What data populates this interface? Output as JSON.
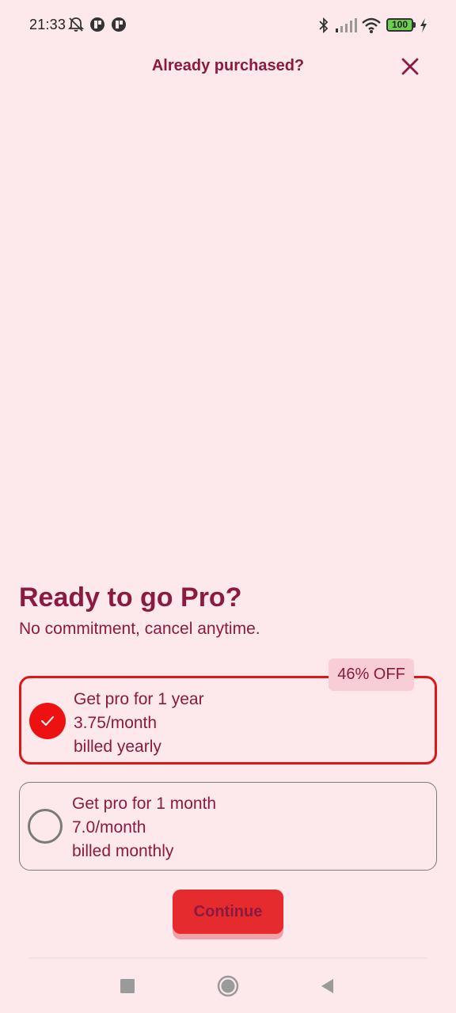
{
  "status_bar": {
    "time": "21:33",
    "battery": "100",
    "icons": [
      "bell-off-icon",
      "app-notification-icon",
      "app-notification-icon",
      "bluetooth-icon",
      "signal-icon",
      "wifi-icon",
      "battery-icon",
      "charging-icon"
    ]
  },
  "header": {
    "already_purchased": "Already purchased?",
    "close_icon": "close-icon"
  },
  "headline": {
    "title": "Ready to go Pro?",
    "subtitle": "No commitment, cancel anytime."
  },
  "plans": [
    {
      "selected": true,
      "badge": "46% OFF",
      "line1": "Get pro for 1 year",
      "line2": "3.75/month",
      "line3": "billed yearly"
    },
    {
      "selected": false,
      "line1": "Get pro for 1 month",
      "line2": "7.0/month",
      "line3": "billed monthly"
    }
  ],
  "continue_label": "Continue",
  "nav": {
    "icons": [
      "recent-apps-icon",
      "home-icon",
      "back-icon"
    ]
  },
  "colors": {
    "background": "#fde9ec",
    "accent_text": "#8a1a3f",
    "selected_border": "#e01515",
    "button": "#e62b2f",
    "badge_bg": "#f9cdd5"
  }
}
